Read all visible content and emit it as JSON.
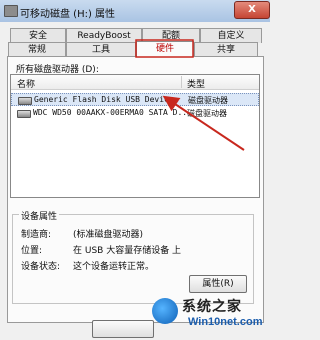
{
  "window": {
    "title": "可移动磁盘 (H:) 属性",
    "close_label": "X"
  },
  "tabs_row1": [
    {
      "label": "安全"
    },
    {
      "label": "ReadyBoost"
    },
    {
      "label": "配额"
    },
    {
      "label": "自定义"
    }
  ],
  "tabs_row2": [
    {
      "label": "常规"
    },
    {
      "label": "工具"
    },
    {
      "label": "硬件",
      "active": true
    },
    {
      "label": "共享"
    }
  ],
  "drives_section": {
    "label": "所有磁盘驱动器 (D):"
  },
  "drives_list": {
    "col_name": "名称",
    "col_type": "类型",
    "rows": [
      {
        "name": "Generic Flash Disk USB Device",
        "type": "磁盘驱动器",
        "selected": true
      },
      {
        "name": "WDC WD50 00AAKX-00ERMA0 SATA D...",
        "type": "磁盘驱动器",
        "selected": false
      }
    ]
  },
  "device_props": {
    "title": "设备属性",
    "manufacturer_label": "制造商:",
    "manufacturer_value": "(标准磁盘驱动器)",
    "location_label": "位置:",
    "location_value": "在 USB 大容量存储设备 上",
    "status_label": "设备状态:",
    "status_value": "这个设备运转正常。",
    "properties_button": "属性(R)"
  },
  "watermark": {
    "line1": "系统之家",
    "line2": "Win10net.com"
  },
  "colors": {
    "arrow": "#c8281e",
    "active_tab_text": "#b00000"
  }
}
